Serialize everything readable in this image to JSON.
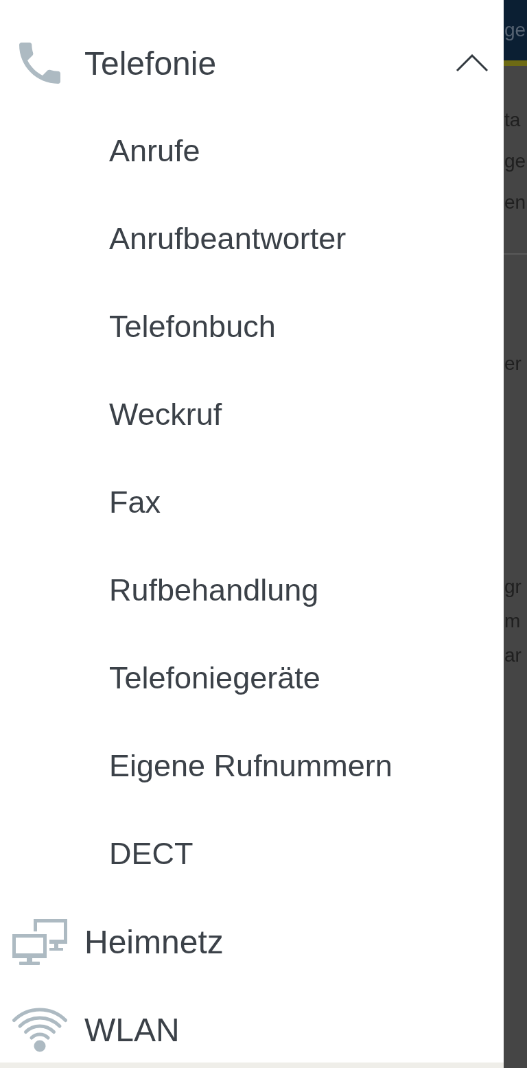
{
  "menu": [
    {
      "label": "Telefonie",
      "expanded": true,
      "children": [
        {
          "label": "Anrufe"
        },
        {
          "label": "Anrufbeantworter"
        },
        {
          "label": "Telefonbuch"
        },
        {
          "label": "Weckruf"
        },
        {
          "label": "Fax"
        },
        {
          "label": "Rufbehandlung"
        },
        {
          "label": "Telefoniegeräte"
        },
        {
          "label": "Eigene Rufnummern"
        },
        {
          "label": "DECT"
        }
      ]
    },
    {
      "label": "Heimnetz"
    },
    {
      "label": "WLAN"
    }
  ],
  "backdrop": {
    "header_text": "ge",
    "paragraphs": [
      [
        "ta",
        "ge",
        "en"
      ],
      [
        "er"
      ],
      [
        "gr",
        "m",
        "ar"
      ]
    ]
  }
}
